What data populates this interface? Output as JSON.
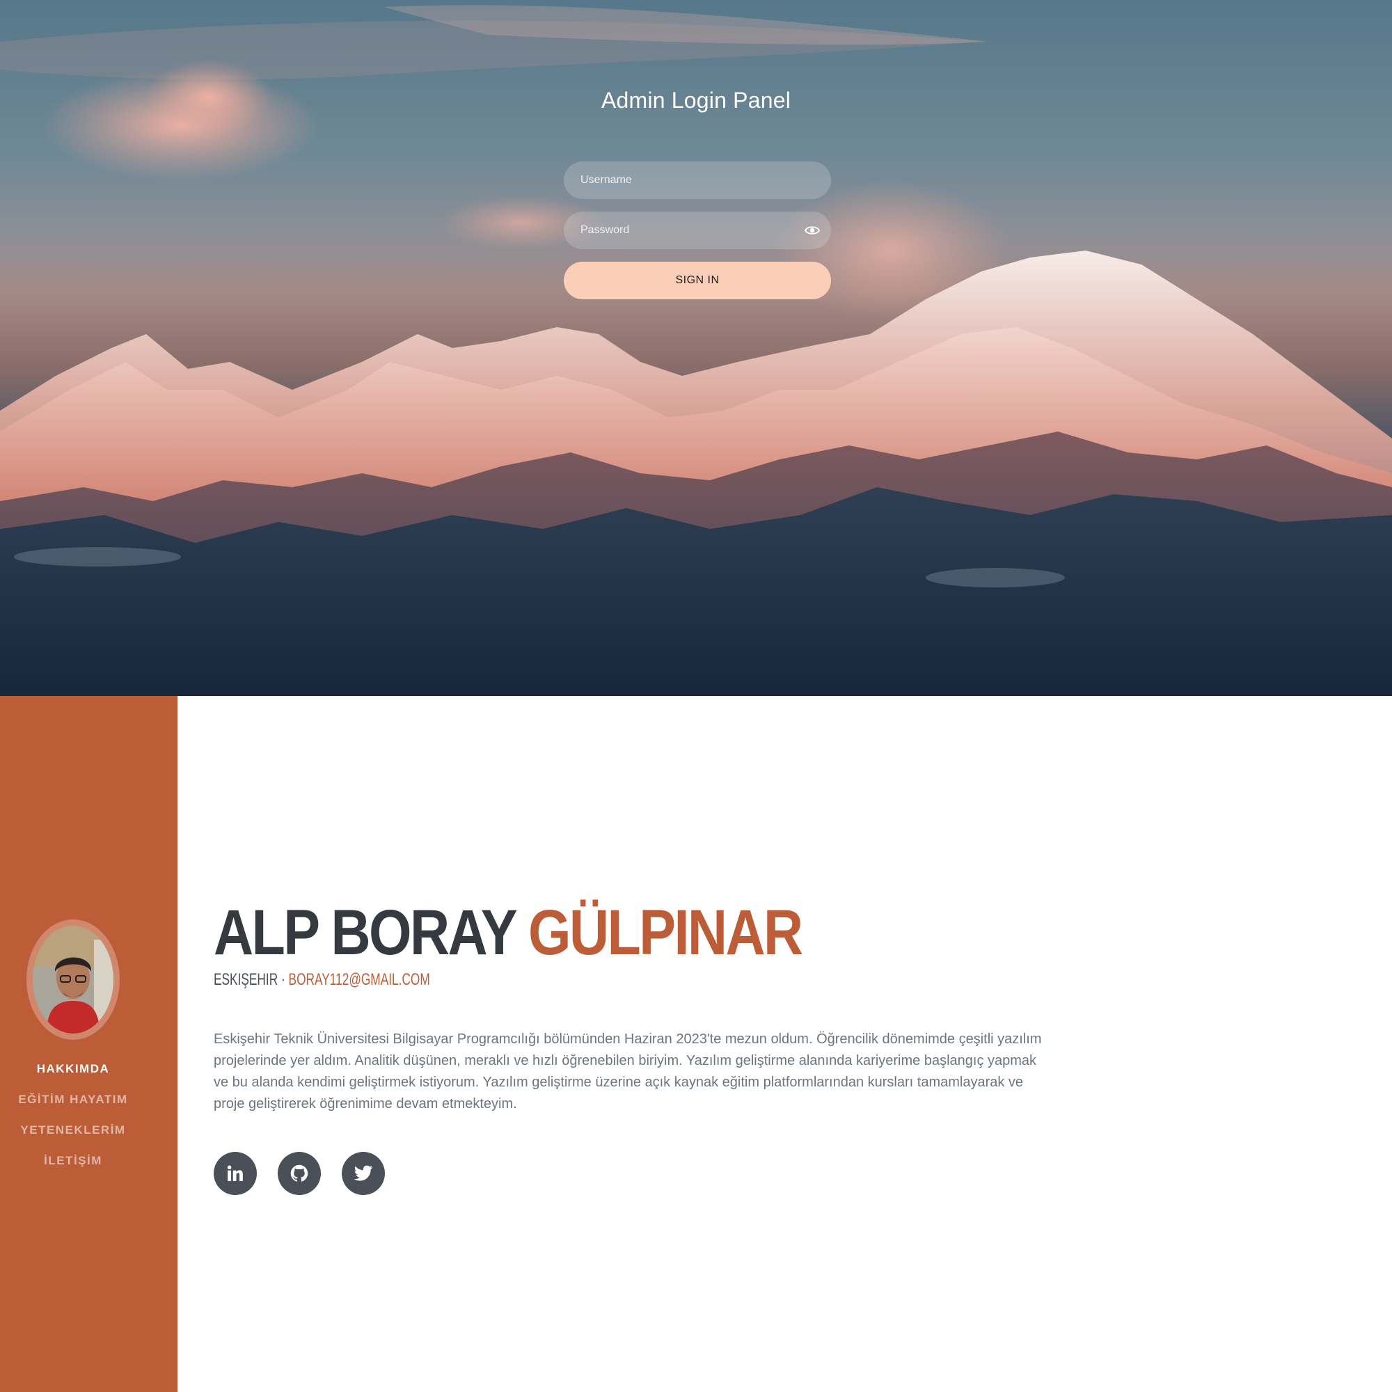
{
  "login": {
    "title": "Admin Login Panel",
    "username_placeholder": "Username",
    "password_placeholder": "Password",
    "signin_label": "SIGN IN"
  },
  "sidebar": {
    "nav_items": [
      {
        "label": "HAKKIMDA"
      },
      {
        "label": "EĞİTİM HAYATIM"
      },
      {
        "label": "YETENEKLERİM"
      },
      {
        "label": "İLETİŞİM"
      }
    ]
  },
  "profile": {
    "first_name": "ALP BORAY",
    "last_name": "GÜLPINAR",
    "location": "ESKIŞEHIR",
    "separator": "·",
    "email": "BORAY112@GMAIL.COM",
    "bio": "Eskişehir Teknik Üniversitesi Bilgisayar Programcılığı bölümünden Haziran 2023'te mezun oldum. Öğrencilik dönemimde çeşitli yazılım projelerinde yer aldım. Analitik düşünen, meraklı ve hızlı öğrenebilen biriyim. Yazılım geliştirme alanında kariyerime başlangıç yapmak ve bu alanda kendimi geliştirmek istiyorum. Yazılım geliştirme üzerine açık kaynak eğitim platformlarından kursları tamamlayarak ve proje geliştirerek öğrenimime devam etmekteyim.",
    "socials": [
      {
        "icon": "linkedin-icon"
      },
      {
        "icon": "github-icon"
      },
      {
        "icon": "twitter-icon"
      }
    ]
  },
  "colors": {
    "accent": "#bd5d38",
    "heading": "#343a40",
    "text": "#6c757d",
    "signin_button": "#fbcfb7",
    "social_bg": "#495057"
  }
}
